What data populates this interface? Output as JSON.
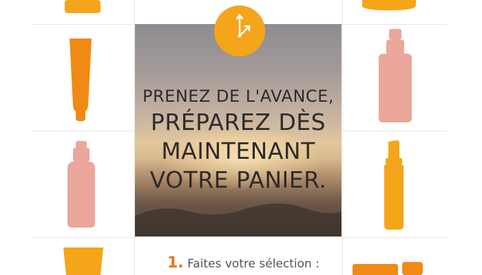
{
  "hero": {
    "line1": "PRENEZ DE L'AVANCE,",
    "line2": "PRÉPAREZ DÈS",
    "line3": "MAINTENANT",
    "line4": "VOTRE PANIER."
  },
  "step": {
    "number": "1.",
    "text": " Faites votre sélection :"
  },
  "icons": {
    "clock": "clock-icon"
  },
  "colors": {
    "orange": "#f5a51a",
    "deep_orange": "#f08a14",
    "pink": "#eba79c",
    "step_number": "#e8731a"
  }
}
